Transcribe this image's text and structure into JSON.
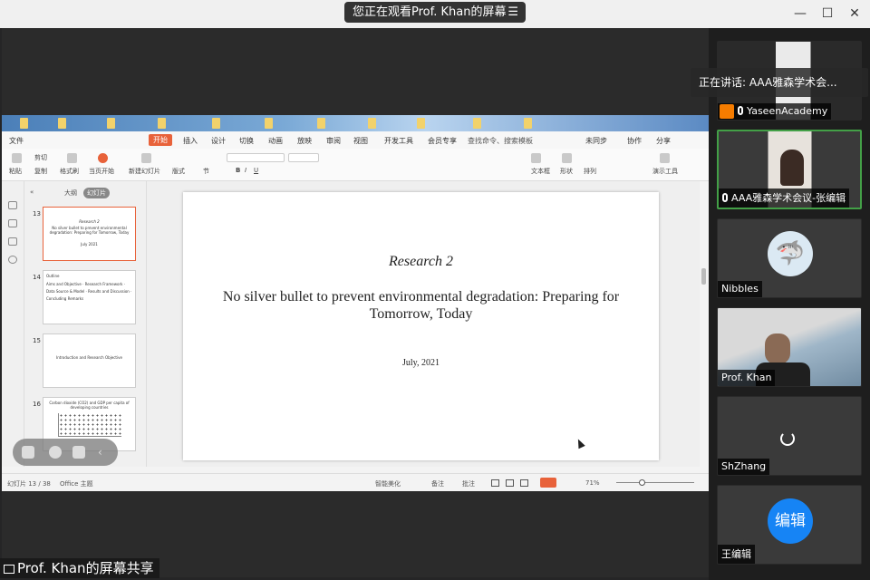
{
  "top_bar": {
    "viewing_text": "您正在观看Prof. Khan的屏幕",
    "menu_glyph": "☰",
    "minimize_glyph": "—",
    "maximize_glyph": "☐",
    "close_glyph": "✕"
  },
  "app": {
    "file_menu": "文件",
    "tabs": [
      "开始",
      "插入",
      "设计",
      "切换",
      "动画",
      "放映",
      "审阅",
      "视图",
      "开发工具",
      "会员专享"
    ],
    "active_tab": "开始",
    "search_placeholder": "查找命令、搜索模板",
    "right_actions": [
      "未同步",
      "协作",
      "分享"
    ],
    "toolbar_labels": [
      "粘贴",
      "剪切",
      "复制",
      "格式刷",
      "当页开始",
      "新建幻灯片",
      "版式",
      "节",
      "文本框",
      "形状",
      "排列",
      "演示工具"
    ],
    "outline_label": "大纲",
    "slides_label": "幻灯片",
    "thumbnails": [
      {
        "num": "13",
        "title": "Research 2",
        "body": "No silver bullet to prevent environmental degradation: Preparing for Tomorrow, Today",
        "date": "July 2021",
        "selected": true
      },
      {
        "num": "14",
        "title": "Outline",
        "body": "Aims and Objective · Research Framework · Data Source & Model · Results and Discussion · Concluding Remarks"
      },
      {
        "num": "15",
        "title": "",
        "body": "Introduction and Research Objective"
      },
      {
        "num": "16",
        "title": "",
        "body": "Carbon dioxide (CO2) and GDP per capita of developing countries"
      }
    ],
    "slide": {
      "title": "Research 2",
      "subtitle": "No silver bullet to prevent environmental degradation: Preparing for Tomorrow, Today",
      "date": "July, 2021"
    },
    "status": {
      "slide_count": "幻灯片 13 / 38",
      "theme": "Office 主题",
      "beautify": "智能美化",
      "notes": "备注",
      "comments": "批注",
      "zoom": "71%"
    }
  },
  "share_label": "Prof. Khan的屏幕共享",
  "speaking": "正在讲话: AAA雅森学术会...",
  "participants": [
    {
      "name": "YaseenAcademy",
      "type": "video-dark",
      "mic": true
    },
    {
      "name": "AAA雅森学术会议-张编辑",
      "type": "video-woman",
      "mic": true,
      "active": true
    },
    {
      "name": "Nibbles",
      "type": "avatar-shark",
      "mic": false
    },
    {
      "name": "Prof. Khan",
      "type": "video-man",
      "mic": false
    },
    {
      "name": "ShZhang",
      "type": "loading",
      "mic": false
    },
    {
      "name": "王编辑",
      "type": "avatar-text",
      "avatar_text": "编辑",
      "mic": false
    }
  ],
  "colors": {
    "accent": "#e8623a",
    "active_border": "#43a047",
    "avatar_blue": "#1684f5"
  }
}
